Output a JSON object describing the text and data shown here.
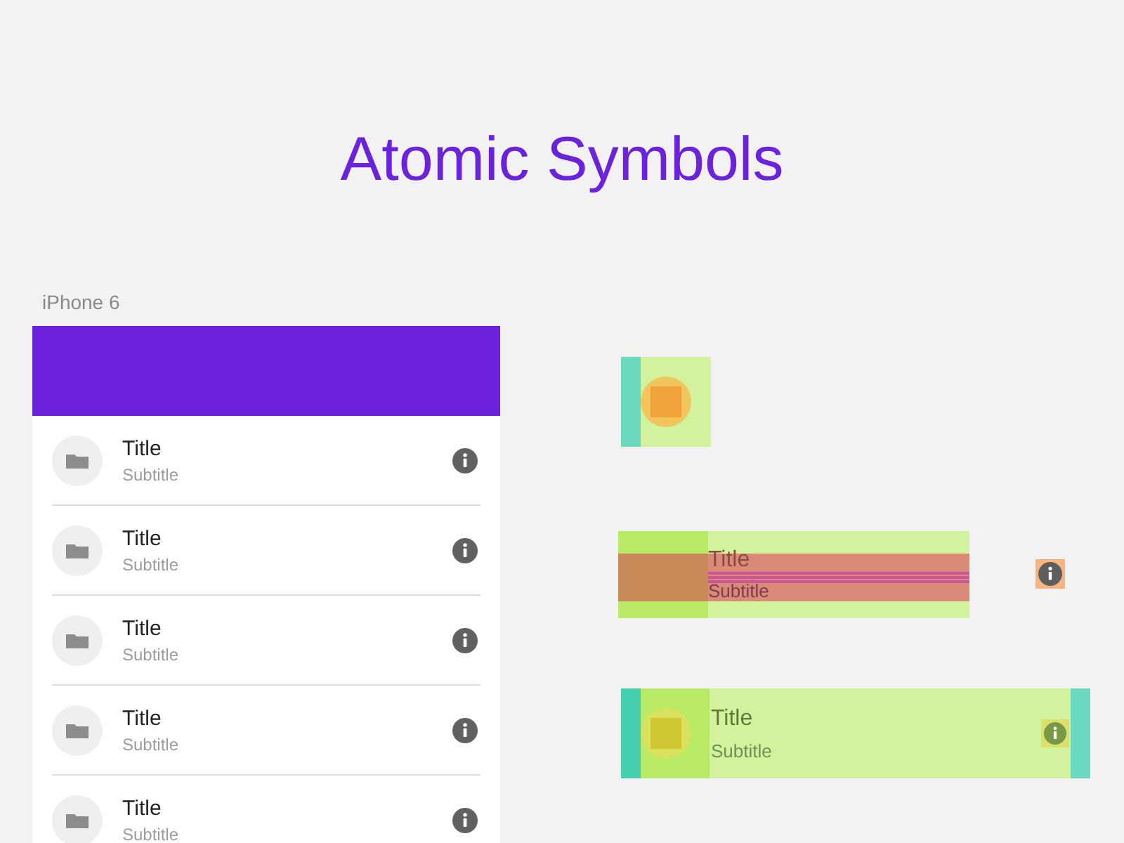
{
  "title": "Atomic Symbols",
  "device": {
    "label": "iPhone 6",
    "rows": [
      {
        "title": "Title",
        "subtitle": "Subtitle"
      },
      {
        "title": "Title",
        "subtitle": "Subtitle"
      },
      {
        "title": "Title",
        "subtitle": "Subtitle"
      },
      {
        "title": "Title",
        "subtitle": "Subtitle"
      },
      {
        "title": "Title",
        "subtitle": "Subtitle"
      }
    ]
  },
  "symbols": [
    {
      "kind": "avatar"
    },
    {
      "kind": "text",
      "title": "Title",
      "subtitle": "Subtitle"
    },
    {
      "kind": "info"
    },
    {
      "kind": "row",
      "title": "Title",
      "subtitle": "Subtitle"
    }
  ]
}
